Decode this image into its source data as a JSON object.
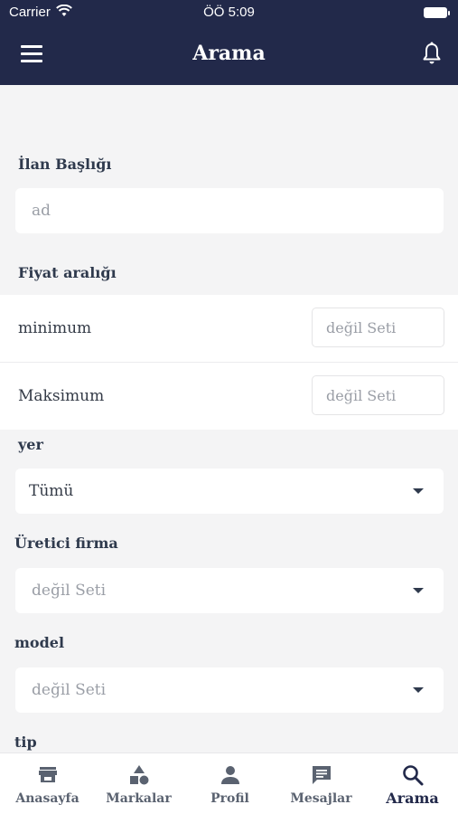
{
  "status_bar": {
    "carrier": "Carrier",
    "time": "ÖÖ 5:09"
  },
  "header": {
    "title": "Arama",
    "menu_icon": "hamburger-icon",
    "bell_icon": "bell-icon"
  },
  "form": {
    "ilan_basligi": {
      "label": "İlan Başlığı",
      "placeholder": "ad"
    },
    "fiyat": {
      "label": "Fiyat aralığı",
      "minimum": {
        "label": "minimum",
        "placeholder": "değil Seti"
      },
      "maksimum": {
        "label": "Maksimum",
        "placeholder": "değil Seti"
      }
    },
    "yer": {
      "label": "yer",
      "value": "Tümü"
    },
    "uretici": {
      "label": "Üretici firma",
      "placeholder": "değil Seti"
    },
    "model": {
      "label": "model",
      "placeholder": "değil Seti"
    },
    "tip": {
      "label": "tip"
    }
  },
  "tabs": [
    {
      "label": "Anasayfa",
      "icon": "store-icon"
    },
    {
      "label": "Markalar",
      "icon": "shapes-icon"
    },
    {
      "label": "Profil",
      "icon": "person-icon"
    },
    {
      "label": "Mesajlar",
      "icon": "message-icon"
    },
    {
      "label": "Arama",
      "icon": "search-icon",
      "active": true
    }
  ],
  "colors": {
    "nav": "#22294a",
    "background": "#f4f4f5",
    "text": "#2f3a4d",
    "placeholder": "#9a9ea6"
  }
}
